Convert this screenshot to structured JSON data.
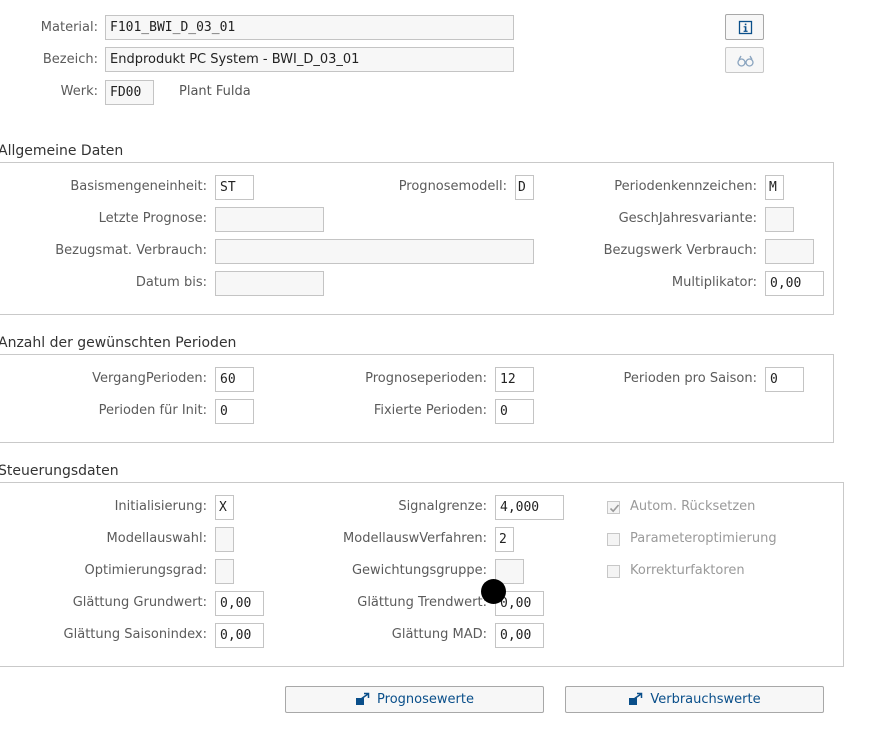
{
  "header": {
    "material_label": "Material:",
    "material_value": "F101_BWI_D_03_01",
    "bezeich_label": "Bezeich:",
    "bezeich_value": "Endprodukt PC System - BWI_D_03_01",
    "werk_label": "Werk:",
    "werk_value": "FD00",
    "werk_text": "Plant Fulda",
    "info_icon": "info-icon",
    "glasses_icon": "glasses-icon"
  },
  "allgemein": {
    "title": "Allgemeine Daten",
    "basismenge_label": "Basismengeneinheit:",
    "basismenge_value": "ST",
    "prognosemodell_label": "Prognosemodell:",
    "prognosemodell_value": "D",
    "periodenkz_label": "Periodenkennzeichen:",
    "periodenkz_value": "M",
    "letzte_prognose_label": "Letzte Prognose:",
    "letzte_prognose_value": "",
    "geschjahr_label": "GeschJahresvariante:",
    "geschjahr_value": "",
    "bezugsmat_label": "Bezugsmat. Verbrauch:",
    "bezugsmat_value": "",
    "bezugswerk_label": "Bezugswerk Verbrauch:",
    "bezugswerk_value": "",
    "datum_bis_label": "Datum bis:",
    "datum_bis_value": "",
    "multiplikator_label": "Multiplikator:",
    "multiplikator_value": "0,00"
  },
  "perioden": {
    "title": "Anzahl der gewünschten Perioden",
    "vergang_label": "VergangPerioden:",
    "vergang_value": "60",
    "prognoseperioden_label": "Prognoseperioden:",
    "prognoseperioden_value": "12",
    "pro_saison_label": "Perioden pro Saison:",
    "pro_saison_value": "0",
    "init_label": "Perioden für Init:",
    "init_value": "0",
    "fixiert_label": "Fixierte Perioden:",
    "fixiert_value": "0"
  },
  "steuerung": {
    "title": "Steuerungsdaten",
    "initialisierung_label": "Initialisierung:",
    "initialisierung_value": "X",
    "signalgrenze_label": "Signalgrenze:",
    "signalgrenze_value": "4,000",
    "autom_label": "Autom. Rücksetzen",
    "modellauswahl_label": "Modellauswahl:",
    "modellauswahl_value": "",
    "modellauswverf_label": "ModellauswVerfahren:",
    "modellauswverf_value": "2",
    "paramopt_label": "Parameteroptimierung",
    "optgrad_label": "Optimierungsgrad:",
    "optgrad_value": "",
    "gewichtung_label": "Gewichtungsgruppe:",
    "gewichtung_value": "",
    "korrektur_label": "Korrekturfaktoren",
    "glatt_grund_label": "Glättung Grundwert:",
    "glatt_grund_value": "0,00",
    "glatt_trend_label": "Glättung Trendwert:",
    "glatt_trend_value": "0,00",
    "glatt_saison_label": "Glättung Saisonindex:",
    "glatt_saison_value": "0,00",
    "glatt_mad_label": "Glättung MAD:",
    "glatt_mad_value": "0,00"
  },
  "footer": {
    "prognosewerte_label": "Prognosewerte",
    "verbrauchswerte_label": "Verbrauchswerte",
    "button_icon": "navigate-icon"
  }
}
